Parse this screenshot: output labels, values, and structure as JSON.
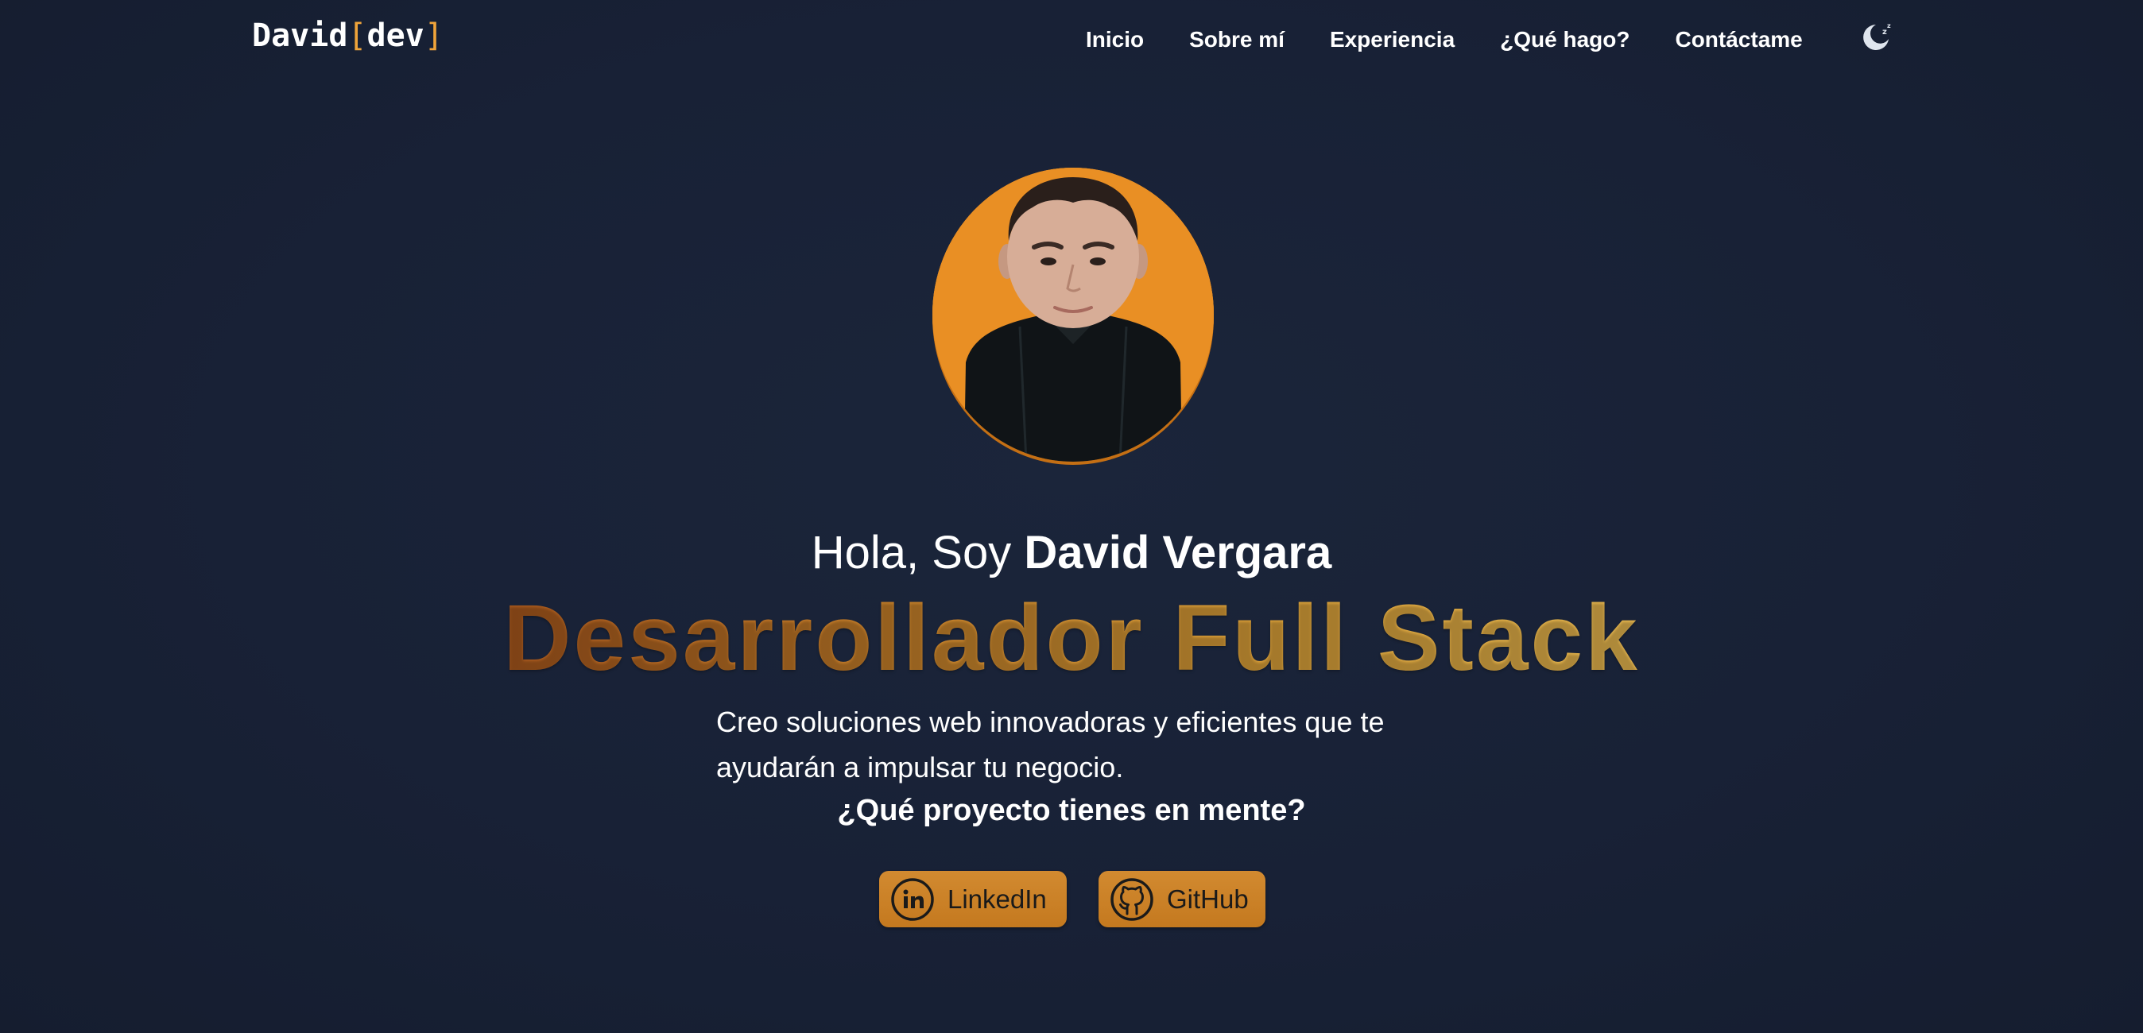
{
  "header": {
    "logo": {
      "name": "David",
      "open_bracket": "[",
      "accent": "dev",
      "close_bracket": "]"
    },
    "nav": [
      {
        "label": "Inicio"
      },
      {
        "label": "Sobre mí"
      },
      {
        "label": "Experiencia"
      },
      {
        "label": "¿Qué hago?"
      },
      {
        "label": "Contáctame"
      }
    ],
    "theme_toggle_icon": "moon-sleep-icon"
  },
  "hero": {
    "greeting_prefix": "Hola, Soy",
    "name": "David Vergara",
    "headline": "Desarrollador Full Stack",
    "description": "Creo soluciones web innovadoras y eficientes que te ayudarán a impulsar tu negocio.",
    "question": "¿Qué proyecto tienes en mente?",
    "social": [
      {
        "label": "LinkedIn",
        "icon": "linkedin-icon"
      },
      {
        "label": "GitHub",
        "icon": "github-icon"
      }
    ]
  },
  "colors": {
    "background": "#172035",
    "accent": "#e98f24",
    "button": "#c97f25"
  }
}
